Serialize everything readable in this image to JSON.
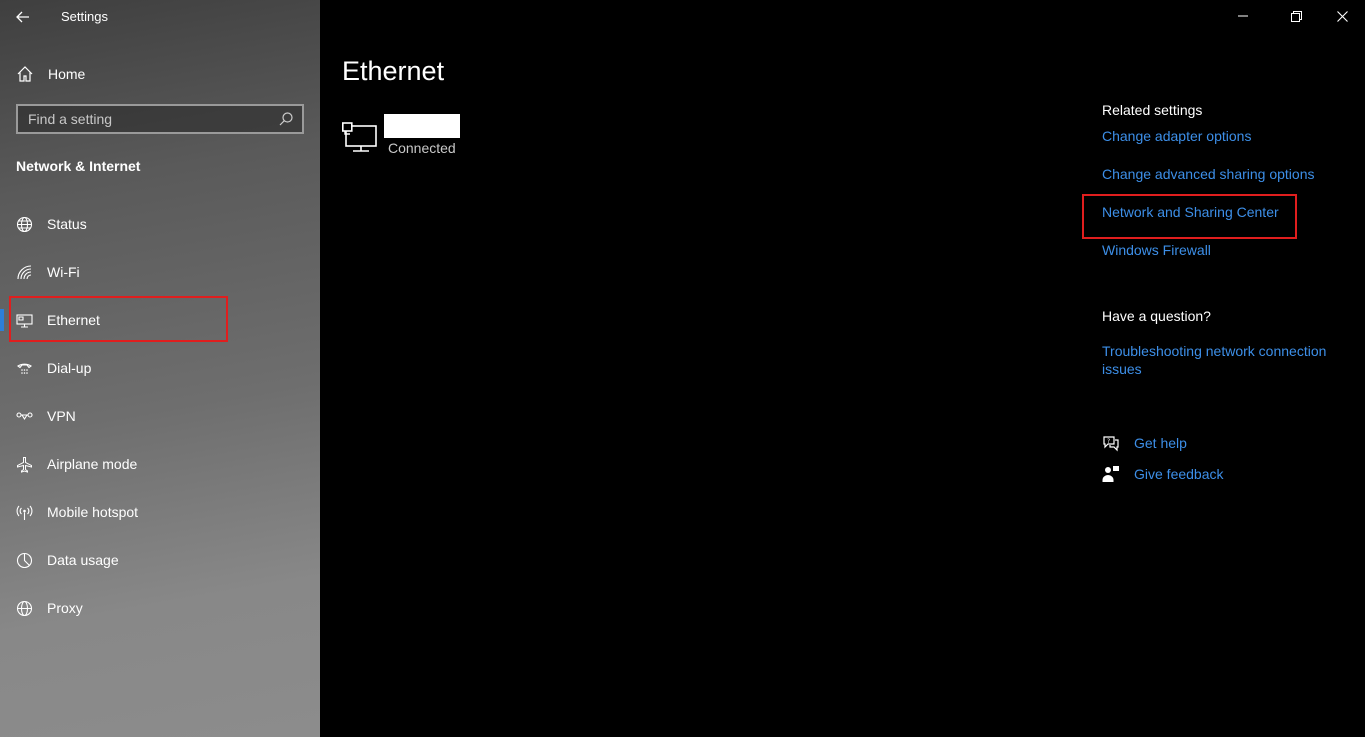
{
  "window": {
    "title": "Settings"
  },
  "sidebar": {
    "home_label": "Home",
    "search_placeholder": "Find a setting",
    "section_title": "Network & Internet",
    "items": [
      {
        "label": "Status",
        "icon": "globe-icon"
      },
      {
        "label": "Wi-Fi",
        "icon": "wifi-icon"
      },
      {
        "label": "Ethernet",
        "icon": "ethernet-icon",
        "selected": true
      },
      {
        "label": "Dial-up",
        "icon": "dialup-icon"
      },
      {
        "label": "VPN",
        "icon": "vpn-icon"
      },
      {
        "label": "Airplane mode",
        "icon": "airplane-icon"
      },
      {
        "label": "Mobile hotspot",
        "icon": "hotspot-icon"
      },
      {
        "label": "Data usage",
        "icon": "data-usage-icon"
      },
      {
        "label": "Proxy",
        "icon": "proxy-icon"
      }
    ]
  },
  "main": {
    "title": "Ethernet",
    "connection": {
      "status": "Connected"
    },
    "related": {
      "heading": "Related settings",
      "links": [
        "Change adapter options",
        "Change advanced sharing options",
        "Network and Sharing Center",
        "Windows Firewall"
      ]
    },
    "question": {
      "heading": "Have a question?",
      "link": "Troubleshooting network connection issues"
    },
    "help": {
      "get_help": "Get help",
      "feedback": "Give feedback"
    }
  },
  "colors": {
    "accent": "#2d7fd8",
    "link": "#3d8fe8",
    "highlight": "#e01e1e"
  }
}
